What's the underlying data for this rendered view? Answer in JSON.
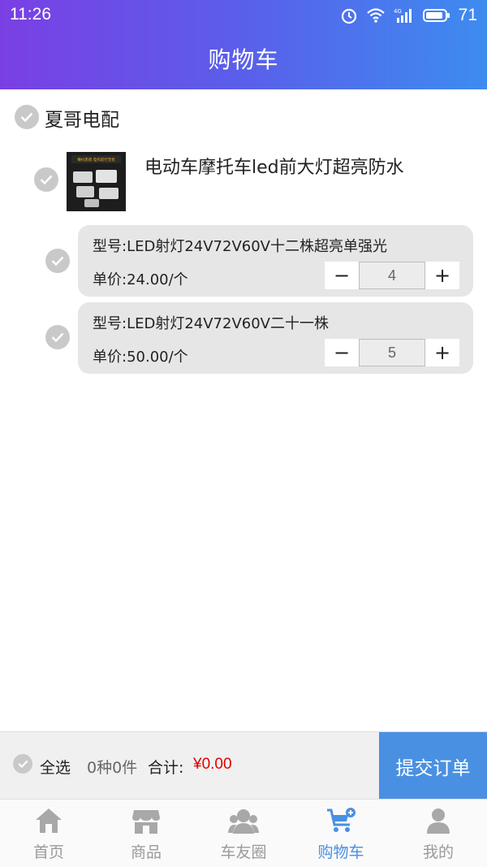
{
  "status_bar": {
    "time": "11:26",
    "battery": "71",
    "network": "4G"
  },
  "header": {
    "title": "购物车"
  },
  "cart": {
    "shop": {
      "name": "夏哥电配",
      "checked": false
    },
    "product": {
      "title": "电动车摩托车led前大灯超亮防水",
      "thumb_text": "横扫黑夜 电作前行无忧",
      "variants": [
        {
          "model": "型号:LED射灯24V72V60V十二株超亮单强光",
          "price": "单价:24.00/个",
          "quantity": "4",
          "minus": "−",
          "plus": "+"
        },
        {
          "model": "型号:LED射灯24V72V60V二十一株",
          "price": "单价:50.00/个",
          "quantity": "5",
          "minus": "−",
          "plus": "+"
        }
      ]
    }
  },
  "summary": {
    "select_all": "全选",
    "count": "0种0件",
    "total_label": "合计:",
    "total_value": "¥0.00",
    "submit": "提交订单"
  },
  "tabs": [
    {
      "label": "首页",
      "icon": "home-icon",
      "active": false
    },
    {
      "label": "商品",
      "icon": "store-icon",
      "active": false
    },
    {
      "label": "车友圈",
      "icon": "community-icon",
      "active": false
    },
    {
      "label": "购物车",
      "icon": "cart-icon",
      "active": true
    },
    {
      "label": "我的",
      "icon": "user-icon",
      "active": false
    }
  ],
  "colors": {
    "accent": "#4a90e2",
    "price": "#e00000",
    "header_start": "#7a3fe4",
    "header_end": "#3d8cf0",
    "check_gray": "#c9c9c9"
  }
}
